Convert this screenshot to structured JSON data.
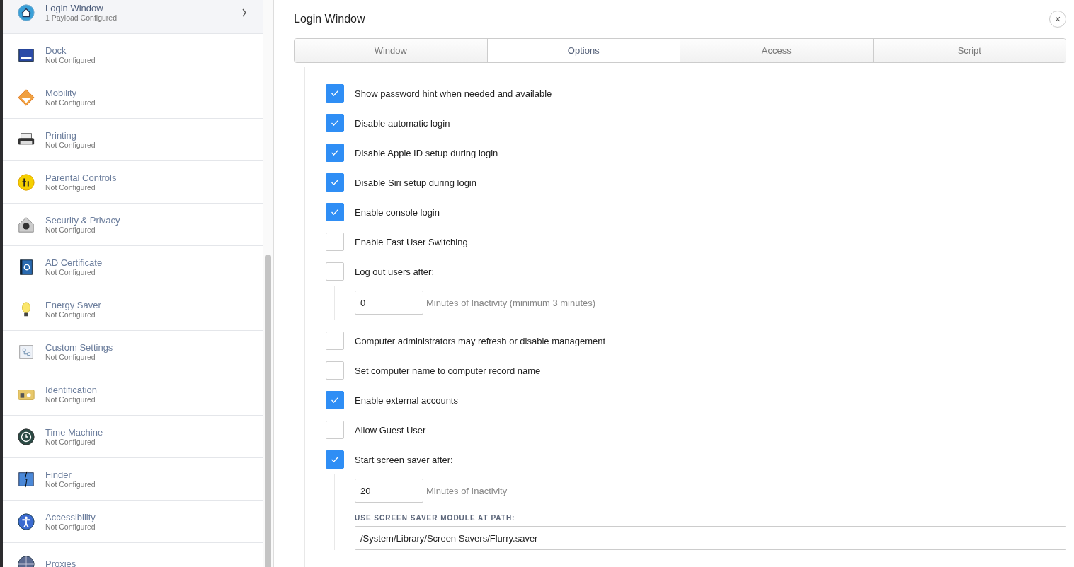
{
  "sidebar": {
    "items": [
      {
        "title": "Login Window",
        "subtitle": "1 Payload Configured",
        "selected": true
      },
      {
        "title": "Dock",
        "subtitle": "Not Configured",
        "selected": false
      },
      {
        "title": "Mobility",
        "subtitle": "Not Configured",
        "selected": false
      },
      {
        "title": "Printing",
        "subtitle": "Not Configured",
        "selected": false
      },
      {
        "title": "Parental Controls",
        "subtitle": "Not Configured",
        "selected": false
      },
      {
        "title": "Security & Privacy",
        "subtitle": "Not Configured",
        "selected": false
      },
      {
        "title": "AD Certificate",
        "subtitle": "Not Configured",
        "selected": false
      },
      {
        "title": "Energy Saver",
        "subtitle": "Not Configured",
        "selected": false
      },
      {
        "title": "Custom Settings",
        "subtitle": "Not Configured",
        "selected": false
      },
      {
        "title": "Identification",
        "subtitle": "Not Configured",
        "selected": false
      },
      {
        "title": "Time Machine",
        "subtitle": "Not Configured",
        "selected": false
      },
      {
        "title": "Finder",
        "subtitle": "Not Configured",
        "selected": false
      },
      {
        "title": "Accessibility",
        "subtitle": "Not Configured",
        "selected": false
      },
      {
        "title": "Proxies",
        "selected": false
      }
    ]
  },
  "panel": {
    "title": "Login Window",
    "close": "×",
    "tabs": [
      {
        "label": "Window",
        "selected": false
      },
      {
        "label": "Options",
        "selected": true
      },
      {
        "label": "Access",
        "selected": false
      },
      {
        "label": "Script",
        "selected": false
      }
    ],
    "options": [
      {
        "kind": "checkbox",
        "label": "Show password hint when needed and available",
        "checked": true
      },
      {
        "kind": "checkbox",
        "label": "Disable automatic login",
        "checked": true
      },
      {
        "kind": "checkbox",
        "label": "Disable Apple ID setup during login",
        "checked": true
      },
      {
        "kind": "checkbox",
        "label": "Disable Siri setup during login",
        "checked": true
      },
      {
        "kind": "checkbox",
        "label": "Enable console login",
        "checked": true
      },
      {
        "kind": "checkbox",
        "label": "Enable Fast User Switching",
        "checked": false
      },
      {
        "kind": "checkbox",
        "label": "Log out users after:",
        "checked": false,
        "fields": [
          {
            "kind": "number",
            "value": "0",
            "suffix": "Minutes of Inactivity (minimum 3 minutes)"
          }
        ]
      },
      {
        "kind": "checkbox",
        "label": "Computer administrators may refresh or disable management",
        "checked": false
      },
      {
        "kind": "checkbox",
        "label": "Set computer name to computer record name",
        "checked": false
      },
      {
        "kind": "checkbox",
        "label": "Enable external accounts",
        "checked": true
      },
      {
        "kind": "checkbox",
        "label": "Allow Guest User",
        "checked": false
      },
      {
        "kind": "checkbox",
        "label": "Start screen saver after:",
        "checked": true,
        "fields": [
          {
            "kind": "number",
            "value": "20",
            "suffix": "Minutes of Inactivity"
          },
          {
            "kind": "path",
            "label": "USE SCREEN SAVER MODULE AT PATH:",
            "value": "/System/Library/Screen Savers/Flurry.saver"
          }
        ]
      }
    ]
  }
}
